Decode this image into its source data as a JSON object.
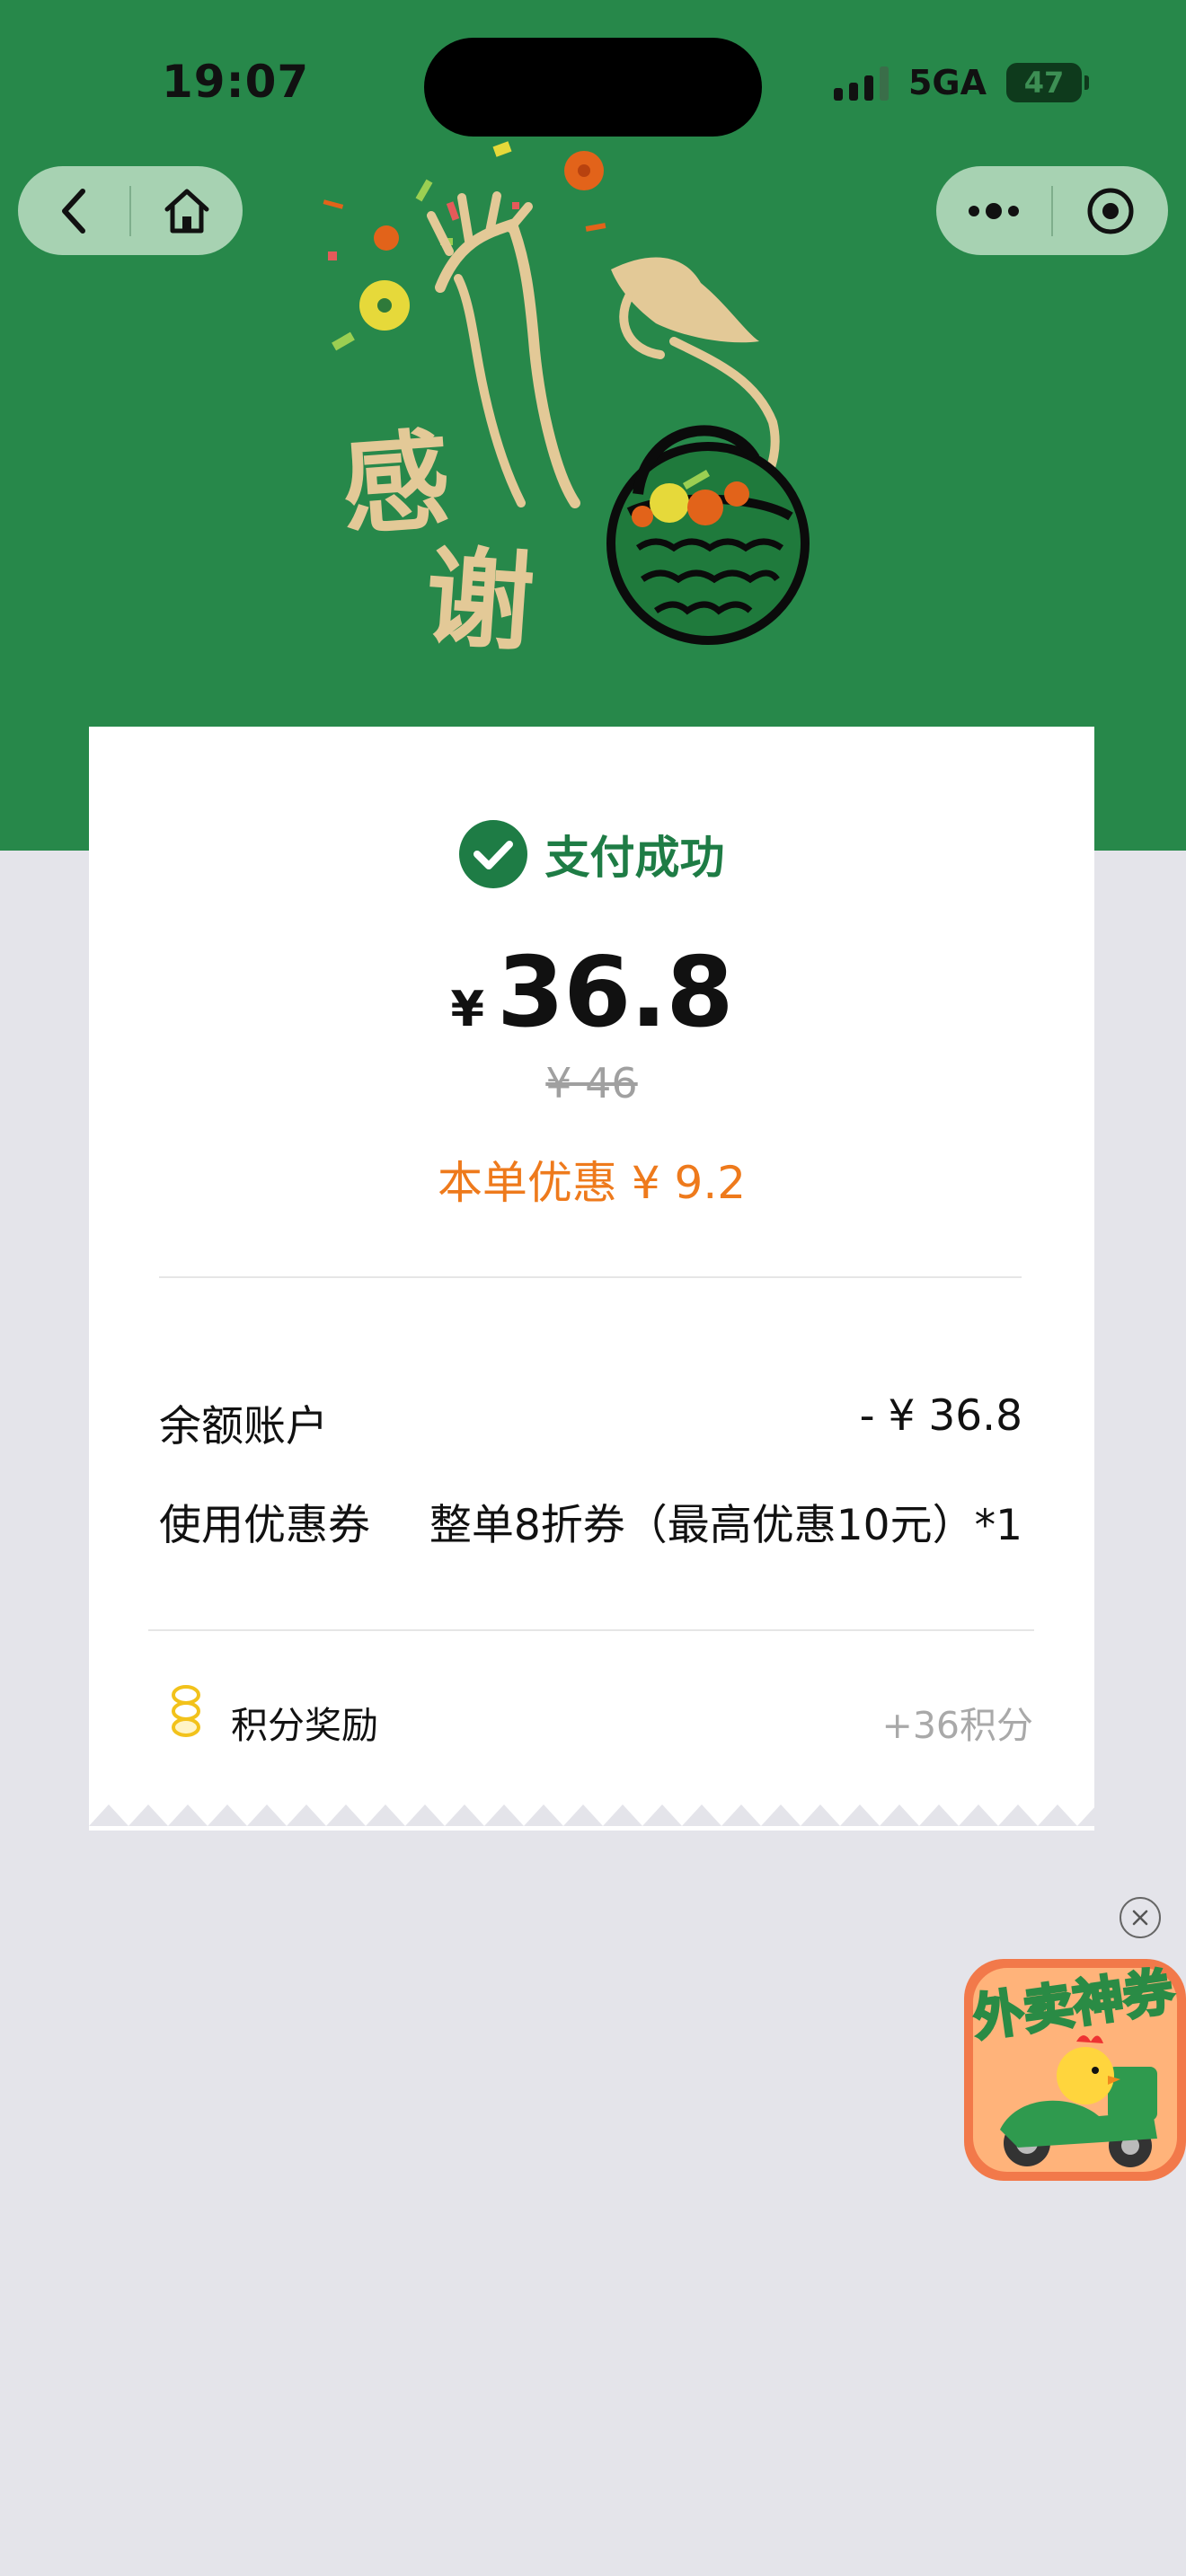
{
  "status_bar": {
    "time": "19:07",
    "network": "5GA",
    "battery": "47"
  },
  "nav": {
    "back_icon": "chevron-left-icon",
    "home_icon": "home-icon",
    "more_icon": "more-dots-icon",
    "close_icon": "target-circle-icon"
  },
  "banner": {
    "text": "感谢"
  },
  "payment": {
    "status": "支付成功",
    "currency": "¥",
    "amount": "36.8",
    "original_price": "¥ 46",
    "discount_text": "本单优惠 ¥ 9.2"
  },
  "details": [
    {
      "label": "余额账户",
      "value": "- ¥ 36.8"
    },
    {
      "label": "使用优惠券",
      "value": "整单8折券（最高优惠10元）*1"
    }
  ],
  "points": {
    "label": "积分奖励",
    "value": "+36积分"
  },
  "ad": {
    "text": "外卖神券"
  },
  "colors": {
    "brand_green": "#27884a",
    "success_green": "#1e7c45",
    "discount_orange": "#ee7a1c",
    "page_bg": "#e4e4ea"
  }
}
